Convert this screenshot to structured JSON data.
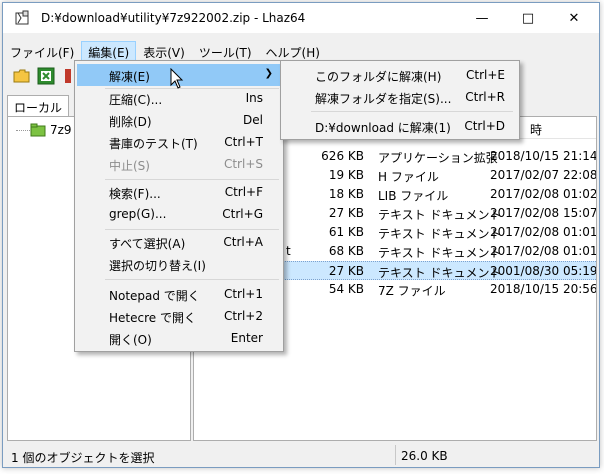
{
  "window": {
    "title": "D:¥download¥utility¥7z922002.zip - Lhaz64",
    "minimize_icon": "minimize-icon",
    "maximize_icon": "maximize-icon",
    "close_icon": "close-icon"
  },
  "menubar": {
    "items": [
      {
        "label": "ファイル(F)"
      },
      {
        "label": "編集(E)"
      },
      {
        "label": "表示(V)"
      },
      {
        "label": "ツール(T)"
      },
      {
        "label": "ヘルプ(H)"
      }
    ]
  },
  "tabs": [
    {
      "label": "ローカル"
    }
  ],
  "tree": {
    "root_label": "7z9"
  },
  "list": {
    "header_right": "時",
    "rows": [
      {
        "name": "",
        "size": "626 KB",
        "type": "アプリケーション拡張",
        "date": "2018/10/15 21:14"
      },
      {
        "name": "",
        "size": "19 KB",
        "type": "H ファイル",
        "date": "2017/02/07 22:08"
      },
      {
        "name": "",
        "size": "18 KB",
        "type": "LIB ファイル",
        "date": "2017/02/08 01:02"
      },
      {
        "name": "",
        "size": "27 KB",
        "type": "テキスト ドキュメント",
        "date": "2017/02/08 15:07"
      },
      {
        "name": "",
        "size": "61 KB",
        "type": "テキスト ドキュメント",
        "date": "2017/02/08 01:01"
      },
      {
        "name": "t",
        "size": "68 KB",
        "type": "テキスト ドキュメント",
        "date": "2017/02/08 01:01"
      },
      {
        "name": "",
        "size": "27 KB",
        "type": "テキスト ドキュメント",
        "date": "2001/08/30 05:19",
        "selected": true
      },
      {
        "name": "",
        "size": "54 KB",
        "type": "7Z ファイル",
        "date": "2018/10/15 20:56"
      }
    ]
  },
  "edit_menu": {
    "items": [
      {
        "label": "解凍(E)",
        "shortcut": "",
        "submenu": true,
        "hover": true
      },
      {
        "label": "圧縮(C)...",
        "shortcut": "Ins"
      },
      {
        "label": "削除(D)",
        "shortcut": "Del"
      },
      {
        "label": "書庫のテスト(T)",
        "shortcut": "Ctrl+T"
      },
      {
        "label": "中止(S)",
        "shortcut": "Ctrl+S",
        "disabled": true
      },
      {
        "label": "検索(F)...",
        "shortcut": "Ctrl+F"
      },
      {
        "label": "grep(G)...",
        "shortcut": "Ctrl+G"
      },
      {
        "label": "すべて選択(A)",
        "shortcut": "Ctrl+A"
      },
      {
        "label": "選択の切り替え(I)",
        "shortcut": ""
      },
      {
        "label": "Notepad で開く",
        "shortcut": "Ctrl+1"
      },
      {
        "label": "Hetecre で開く",
        "shortcut": "Ctrl+2"
      },
      {
        "label": "開く(O)",
        "shortcut": "Enter"
      }
    ]
  },
  "extract_submenu": {
    "items": [
      {
        "label": "このフォルダに解凍(H)",
        "shortcut": "Ctrl+E"
      },
      {
        "label": "解凍フォルダを指定(S)...",
        "shortcut": "Ctrl+R"
      },
      {
        "label": "D:¥download に解凍(1)",
        "shortcut": "Ctrl+D"
      }
    ]
  },
  "status": {
    "selection_text": "1 個のオブジェクトを選択",
    "size_text": "26.0 KB"
  },
  "colors": {
    "menu_hover": "#91c9f7",
    "selected_row": "#cce8ff",
    "window_border": "#7a9cc0"
  }
}
